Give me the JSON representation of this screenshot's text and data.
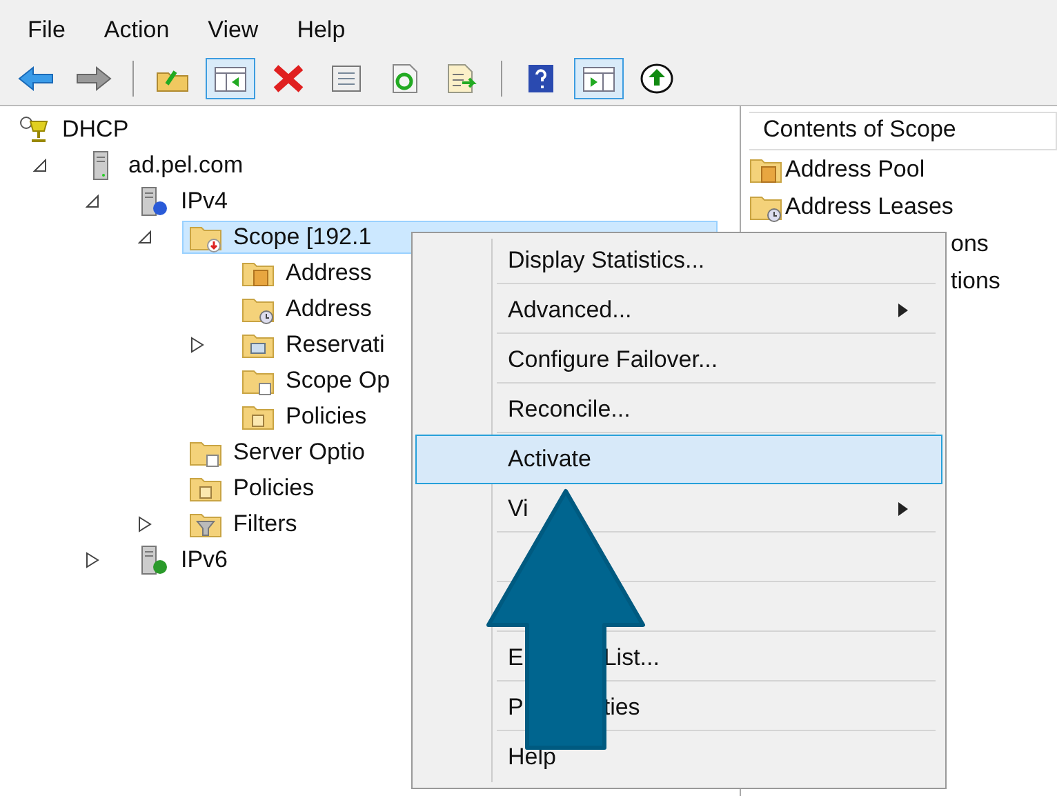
{
  "menu_bar": [
    "File",
    "Action",
    "View",
    "Help"
  ],
  "toolbar": [
    {
      "kind": "back",
      "pressed": false
    },
    {
      "kind": "forward",
      "pressed": false
    },
    {
      "kind": "separator"
    },
    {
      "kind": "up",
      "pressed": false
    },
    {
      "kind": "tree",
      "pressed": true
    },
    {
      "kind": "delete",
      "pressed": false
    },
    {
      "kind": "properties",
      "pressed": false
    },
    {
      "kind": "refresh",
      "pressed": false
    },
    {
      "kind": "export",
      "pressed": false
    },
    {
      "kind": "separator"
    },
    {
      "kind": "help",
      "pressed": false
    },
    {
      "kind": "action",
      "pressed": true
    },
    {
      "kind": "activate",
      "pressed": false
    }
  ],
  "tree": [
    {
      "label": "DHCP",
      "kind": "dhcp",
      "selected": false,
      "children": [
        {
          "label": "ad.pel.com",
          "kind": "server",
          "expanded": true,
          "selected": false,
          "children": [
            {
              "label": "IPv4",
              "kind": "ipv4",
              "expanded": true,
              "selected": false,
              "children": [
                {
                  "label": "Scope [192.1",
                  "kind": "scope",
                  "expanded": true,
                  "selected": true,
                  "children": [
                    {
                      "label": "Address",
                      "kind": "pool",
                      "selected": false
                    },
                    {
                      "label": "Address",
                      "kind": "leases",
                      "selected": false
                    },
                    {
                      "label": "Reservati",
                      "kind": "reservations",
                      "expanded": false,
                      "selected": false
                    },
                    {
                      "label": "Scope Op",
                      "kind": "options",
                      "selected": false
                    },
                    {
                      "label": "Policies",
                      "kind": "policies",
                      "selected": false
                    }
                  ]
                },
                {
                  "label": "Server Optio",
                  "kind": "options",
                  "selected": false
                },
                {
                  "label": "Policies",
                  "kind": "policies",
                  "selected": false
                },
                {
                  "label": "Filters",
                  "kind": "filters",
                  "expanded": false,
                  "selected": false
                }
              ]
            },
            {
              "label": "IPv6",
              "kind": "ipv6",
              "expanded": false,
              "selected": false
            }
          ]
        }
      ]
    }
  ],
  "contents": {
    "header": "Contents of Scope",
    "items": [
      {
        "label": "Address Pool",
        "kind": "pool",
        "covered": false
      },
      {
        "label": "Address Leases",
        "kind": "leases",
        "covered": false
      },
      {
        "label": "ons",
        "covered": true
      },
      {
        "label": "tions",
        "covered": true
      }
    ]
  },
  "context_menu": [
    {
      "label": "Display Statistics...",
      "submenu": false,
      "selected": false
    },
    {
      "label": "Advanced...",
      "submenu": true,
      "selected": false
    },
    {
      "label": "Configure Failover...",
      "submenu": false,
      "selected": false
    },
    {
      "label": "Reconcile...",
      "submenu": false,
      "selected": false
    },
    {
      "label": "Activate",
      "submenu": false,
      "selected": true
    },
    {
      "label": "Vi",
      "submenu": true,
      "selected": false
    },
    {
      "submenu": false,
      "selected": false
    },
    {
      "submenu": false,
      "selected": false
    },
    {
      "label": "E",
      "label_end": "List...",
      "submenu": false,
      "selected": false
    },
    {
      "label": "P",
      "label_end": "ties",
      "submenu": false,
      "selected": false
    },
    {
      "label": "Help",
      "submenu": false,
      "selected": false
    }
  ]
}
